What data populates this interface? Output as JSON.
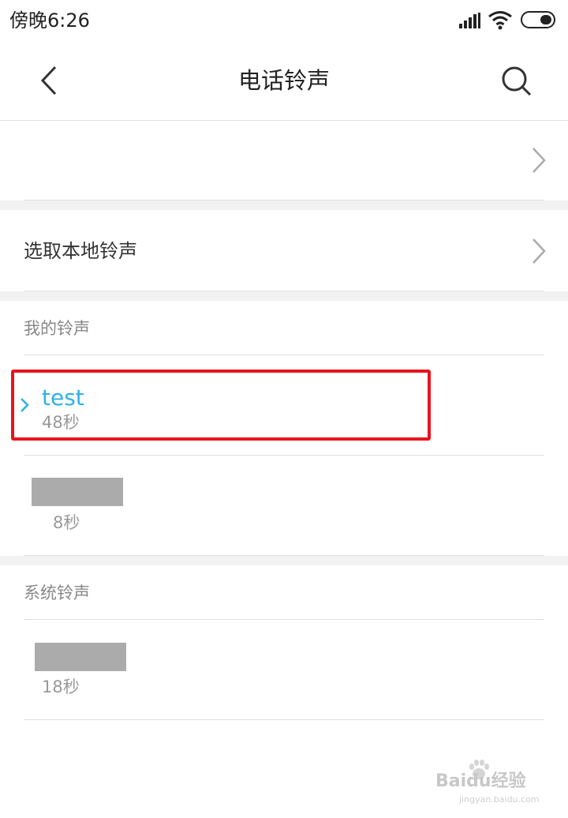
{
  "status_bar": {
    "time": "傍晚6:26"
  },
  "header": {
    "title": "电话铃声"
  },
  "rows": {
    "local_ringtone_label": "选取本地铃声"
  },
  "my_ringtones": {
    "section_title": "我的铃声",
    "items": [
      {
        "title": "test",
        "duration": "48秒",
        "selected": true
      },
      {
        "title": "",
        "duration": "8秒",
        "selected": false
      }
    ]
  },
  "system_ringtones": {
    "section_title": "系统铃声",
    "items": [
      {
        "title": "",
        "duration": "18秒"
      }
    ]
  },
  "watermark": {
    "brand": "Bai",
    "brand2": "du",
    "brand_cn": "经验",
    "url": "jingyan.baidu.com"
  },
  "colors": {
    "accent": "#2db2e8",
    "highlight_border": "#e8141c",
    "divider": "#e0e0e0",
    "section_bg": "#f2f2f2"
  }
}
